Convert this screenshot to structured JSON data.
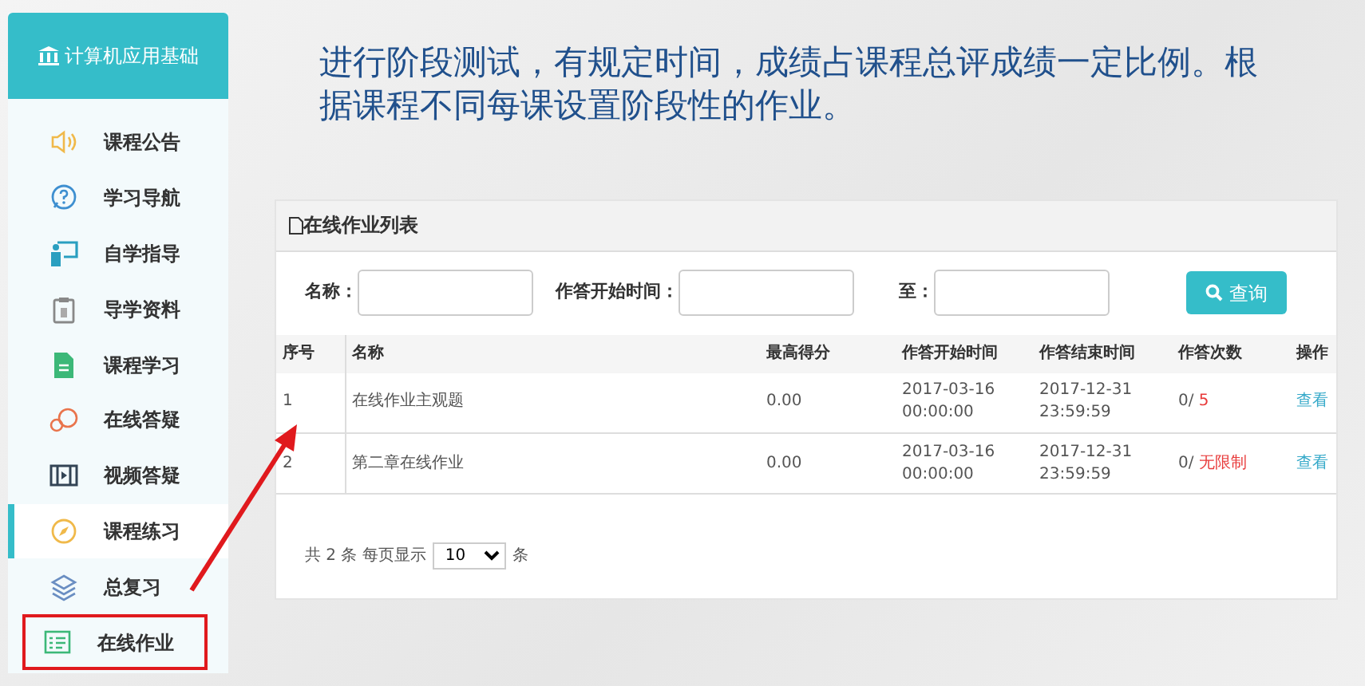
{
  "sidebar": {
    "title": "计算机应用基础",
    "items": [
      {
        "label": "课程公告",
        "selected": false,
        "highlighted": false
      },
      {
        "label": "学习导航",
        "selected": false,
        "highlighted": false
      },
      {
        "label": "自学指导",
        "selected": false,
        "highlighted": false
      },
      {
        "label": "导学资料",
        "selected": false,
        "highlighted": false
      },
      {
        "label": "课程学习",
        "selected": false,
        "highlighted": false
      },
      {
        "label": "在线答疑",
        "selected": false,
        "highlighted": false
      },
      {
        "label": "视频答疑",
        "selected": false,
        "highlighted": false
      },
      {
        "label": "课程练习",
        "selected": true,
        "highlighted": false
      },
      {
        "label": "总复习",
        "selected": false,
        "highlighted": false
      },
      {
        "label": "在线作业",
        "selected": false,
        "highlighted": true
      }
    ]
  },
  "heading": "进行阶段测试，有规定时间，成绩占课程总评成绩一定比例。根据课程不同每课设置阶段性的作业。",
  "panel": {
    "title": "在线作业列表",
    "filters": [
      {
        "label": "名称："
      },
      {
        "label": "作答开始时间："
      },
      {
        "label": "至："
      }
    ],
    "search_button": "查询",
    "table": {
      "columns": [
        "序号",
        "名称",
        "最高得分",
        "作答开始时间",
        "作答结束时间",
        "作答次数",
        "操作"
      ],
      "rows": [
        {
          "no": "1",
          "name": "在线作业主观题",
          "score": "0.00",
          "start": [
            "2017-03-16",
            "00:00:00"
          ],
          "end": [
            "2017-12-31",
            "23:59:59"
          ],
          "attempts": "0/",
          "limit": "5",
          "action": "查看"
        },
        {
          "no": "2",
          "name": "第二章在线作业",
          "score": "0.00",
          "start": [
            "2017-03-16",
            "00:00:00"
          ],
          "end": [
            "2017-12-31",
            "23:59:59"
          ],
          "attempts": "0/",
          "limit": "无限制",
          "action": "查看"
        }
      ]
    },
    "pagination": {
      "prefix": "共 2 条 每页显示",
      "page_size": "10",
      "suffix": "条"
    }
  }
}
